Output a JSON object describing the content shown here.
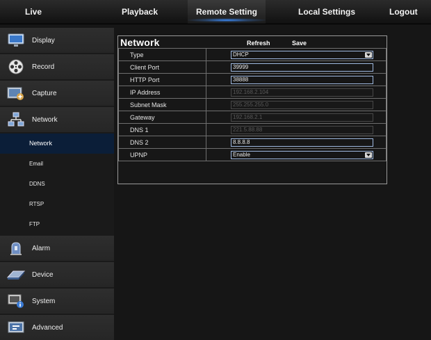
{
  "nav": {
    "tabs": [
      "Live",
      "Playback",
      "Remote Setting",
      "Local Settings",
      "Logout"
    ],
    "active": "Remote Setting"
  },
  "sidebar": {
    "main": [
      {
        "label": "Display",
        "icon": "monitor-icon"
      },
      {
        "label": "Record",
        "icon": "film-reel-icon"
      },
      {
        "label": "Capture",
        "icon": "capture-icon"
      },
      {
        "label": "Network",
        "icon": "network-icon"
      },
      {
        "label": "Alarm",
        "icon": "alarm-icon"
      },
      {
        "label": "Device",
        "icon": "device-icon"
      },
      {
        "label": "System",
        "icon": "system-info-icon"
      },
      {
        "label": "Advanced",
        "icon": "advanced-icon"
      }
    ],
    "network_sub": [
      "Network",
      "Email",
      "DDNS",
      "RTSP",
      "FTP"
    ],
    "selected_sub": "Network"
  },
  "panel": {
    "title": "Network",
    "refresh_label": "Refresh",
    "save_label": "Save",
    "rows": [
      {
        "label": "Type",
        "value": "DHCP"
      },
      {
        "label": "Client Port",
        "value": "39999"
      },
      {
        "label": "HTTP Port",
        "value": "38888"
      },
      {
        "label": "IP Address",
        "value": "192.168.2.104"
      },
      {
        "label": "Subnet Mask",
        "value": "255.255.255.0"
      },
      {
        "label": "Gateway",
        "value": "192.168.2.1"
      },
      {
        "label": "DNS 1",
        "value": "221.5.88.88"
      },
      {
        "label": "DNS 2",
        "value": "8.8.8.8"
      },
      {
        "label": "UPNP",
        "value": "Enable"
      }
    ]
  },
  "colors": {
    "accent_blue": "#3c8eff",
    "selected_sub_bg": "#0b1e38",
    "field_border": "#9fb9e0"
  }
}
